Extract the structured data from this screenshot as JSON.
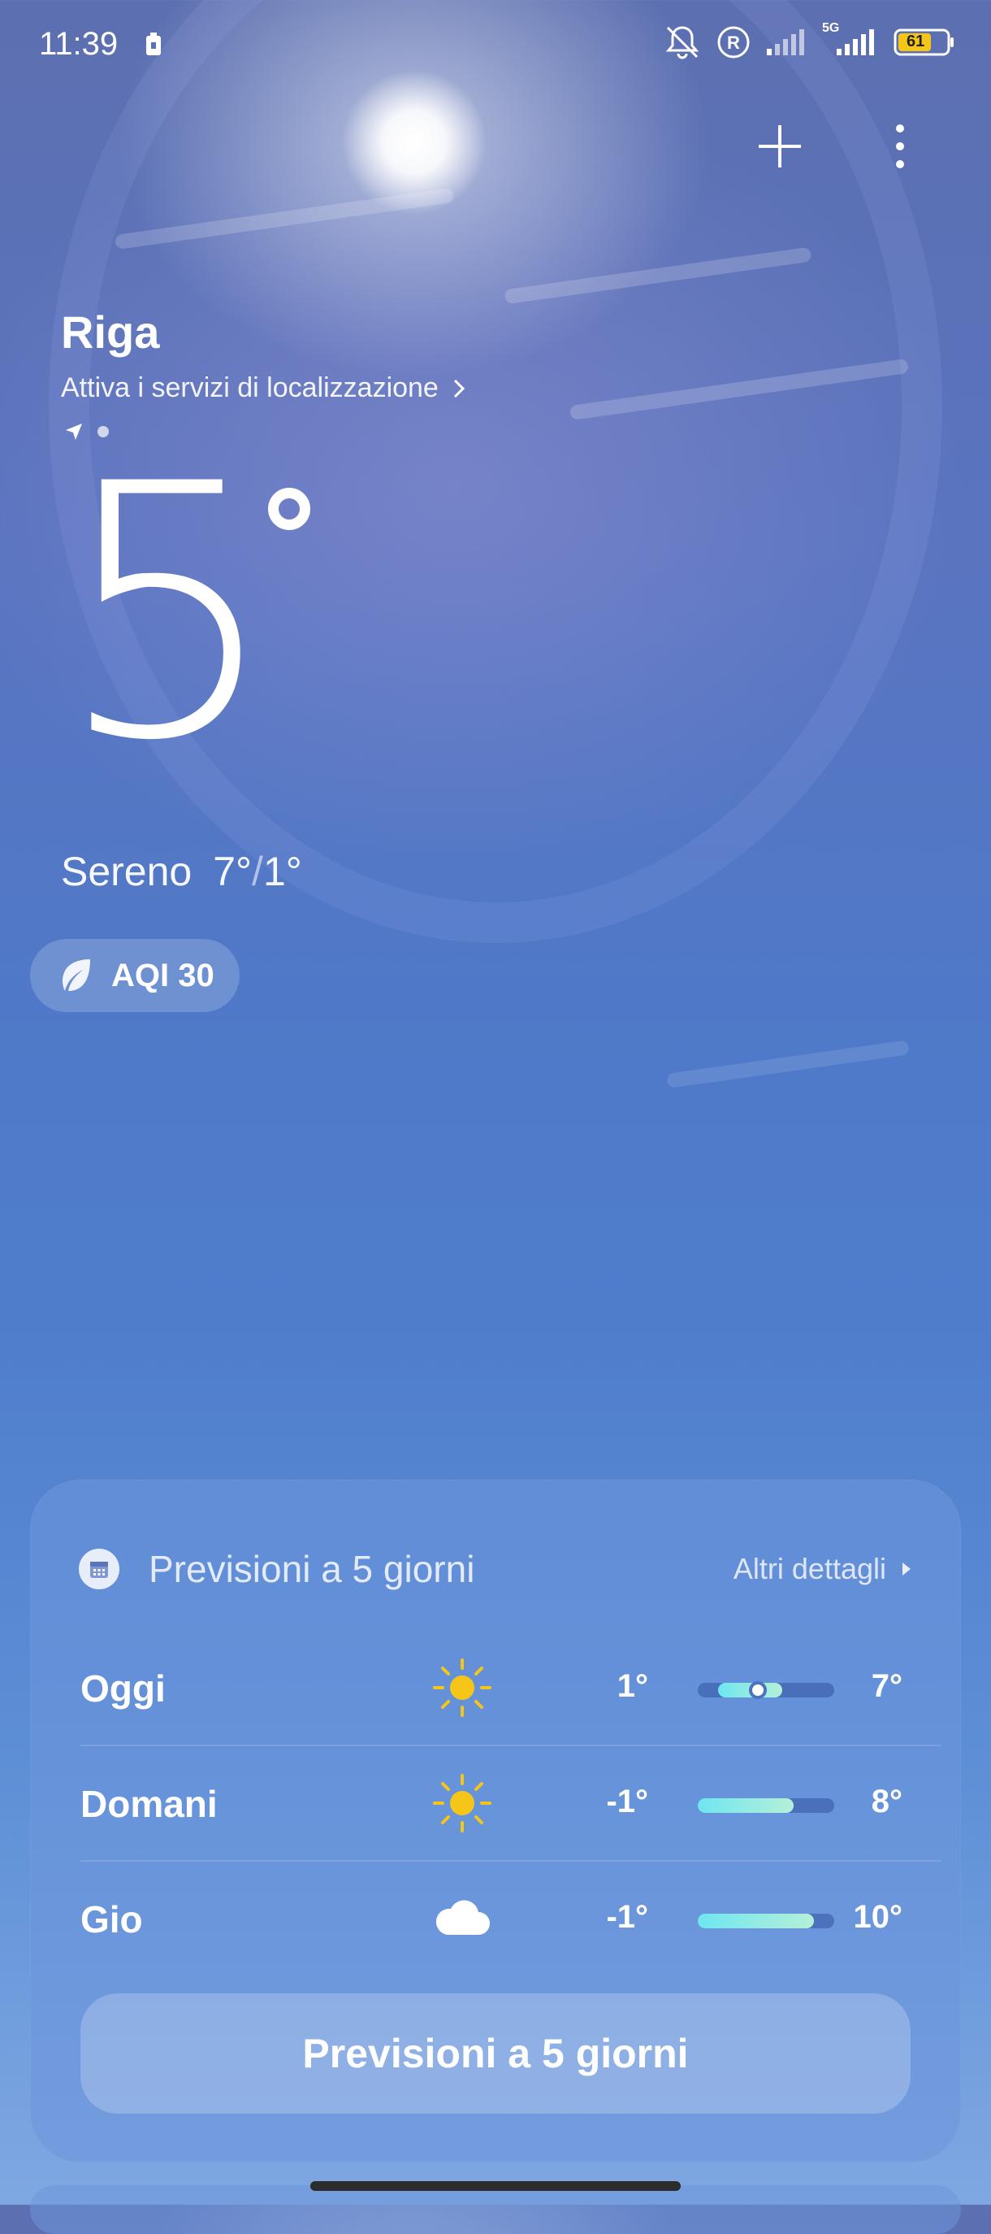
{
  "status": {
    "time": "11:39",
    "battery": "61",
    "network": "5G"
  },
  "header": {
    "add_icon": "plus-icon",
    "menu_icon": "vertical-dots-icon"
  },
  "location": {
    "city": "Riga",
    "location_services": "Attiva i servizi di localizzazione"
  },
  "current": {
    "temperature": "5",
    "condition": "Sereno",
    "range_high": "7°",
    "range_sep": "/",
    "range_low": "1°",
    "aqi_label": "AQI 30"
  },
  "forecast": {
    "title": "Previsioni a 5 giorni",
    "more_label": "Altri dettagli",
    "days": [
      {
        "day": "Oggi",
        "icon": "sun-icon",
        "low": "1°",
        "high": "7°",
        "fill_start": 0.15,
        "fill_end": 0.62,
        "now_pos": 0.44
      },
      {
        "day": "Domani",
        "icon": "sun-icon",
        "low": "-1°",
        "high": "8°",
        "fill_start": 0.0,
        "fill_end": 0.7
      },
      {
        "day": "Gio",
        "icon": "cloud-icon",
        "low": "-1°",
        "high": "10°",
        "fill_start": 0.0,
        "fill_end": 0.85
      }
    ],
    "button_label": "Previsioni a 5 giorni"
  },
  "colors": {
    "sun": "#f5c518",
    "bar_fill": "#6ee6f0"
  }
}
